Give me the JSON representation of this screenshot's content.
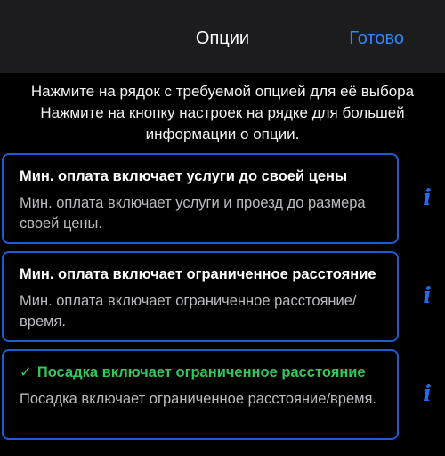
{
  "nav": {
    "title": "Опции",
    "done_label": "Готово"
  },
  "intro_text": "Нажмите на рядок с требуемой опцией для её выбора Нажмите на кнопку настроек на рядке для большей информации о опции.",
  "options": [
    {
      "title": "Мин. оплата включает услуги до своей цены",
      "description": "Мин. оплата включает услуги и проезд до размера своей цены.",
      "selected": false,
      "info_icon": "info-icon"
    },
    {
      "title": "Мин. оплата включает ограниченное расстояние",
      "description": "Мин. оплата включает ограниченное расстояние/время.",
      "selected": false,
      "info_icon": "info-icon"
    },
    {
      "title": "Посадка включает ограниченное расстояние",
      "description": "Посадка включает ограниченное расстояние/время.",
      "selected": true,
      "check_mark": "✓",
      "info_icon": "info-icon"
    }
  ],
  "colors": {
    "accent": "#2f86f6",
    "selected": "#31c759",
    "border": "#1e5bd0",
    "nav_background": "#1c1c1e"
  }
}
